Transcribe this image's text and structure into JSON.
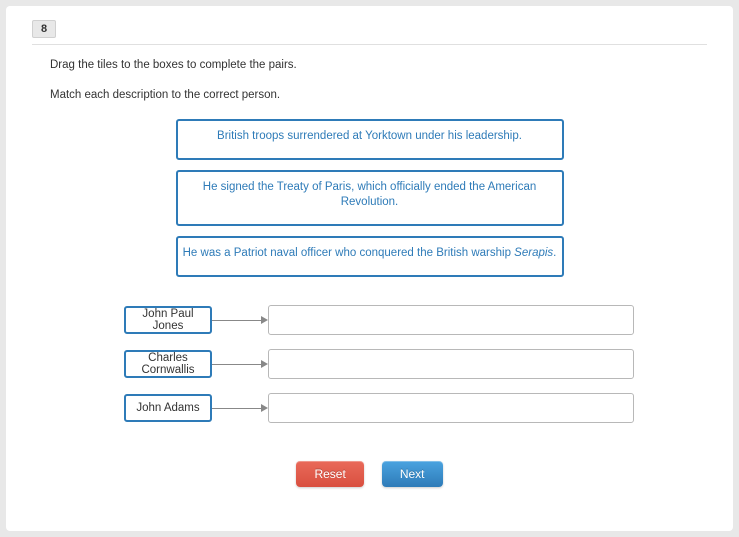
{
  "question_number": "8",
  "instruction_1": "Drag the tiles to the boxes to complete the pairs.",
  "instruction_2": "Match each description to the correct person.",
  "tiles": [
    {
      "text": "British troops surrendered at Yorktown under his leadership."
    },
    {
      "text": "He signed the Treaty of Paris, which officially ended the American Revolution."
    },
    {
      "text_prefix": "He was a Patriot naval officer who conquered the British warship ",
      "text_italic": "Serapis",
      "text_suffix": "."
    }
  ],
  "people": [
    {
      "name": "John Paul Jones"
    },
    {
      "name": "Charles Cornwallis"
    },
    {
      "name": "John Adams"
    }
  ],
  "buttons": {
    "reset": "Reset",
    "next": "Next"
  }
}
